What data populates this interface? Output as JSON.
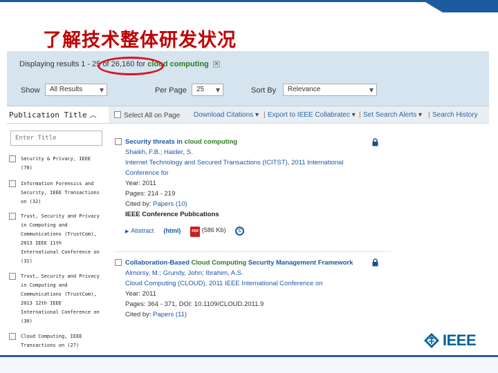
{
  "slide": {
    "title": "了解技术整体研发状况",
    "logo_text": "IEEE",
    "colors": {
      "title": "#c00000",
      "brand": "#00629b",
      "accent_bar": "#1e5aa0",
      "highlight_ring": "#d8141d"
    }
  },
  "search": {
    "results_prefix": "Displaying results 1 - 25 of 26,160 for",
    "query": "cloud computing",
    "clear_icon": "close-icon",
    "show_label": "Show",
    "show_value": "All Results",
    "per_page_label": "Per Page",
    "per_page_value": "25",
    "sort_label": "Sort By",
    "sort_value": "Relevance"
  },
  "filters": {
    "header": "Publication Title",
    "title_placeholder": "Enter Title",
    "items": [
      {
        "label": "Security & Privacy, IEEE\n(70)"
      },
      {
        "label": "Information Forensics and\nSecurity, IEEE Transactions\non (32)"
      },
      {
        "label": "Trust, Security and Privacy\nin Computing and\nCommunications (TrustCom),\n2013 IEEE 11th\nInternational Conference on\n(31)"
      },
      {
        "label": "Trust, Security and Privacy\nin Computing and\nCommunications (TrustCom),\n2013 12th IEEE\nInternational Conference on\n(30)"
      },
      {
        "label": "Cloud Computing, IEEE\nTransactions on (27)"
      }
    ]
  },
  "toolbar": {
    "select_all": "Select All on Page",
    "download": "Download Citations",
    "export": "Export to IEEE Collabratec",
    "alerts": "Set Search Alerts",
    "history": "Search History"
  },
  "results": [
    {
      "title_pre": "Security threats in ",
      "title_hl": "cloud computing",
      "title_post": "",
      "authors": "Shaikh, F.B.; Haider, S.",
      "venue": "Internet Technology and Secured Transactions (ICITST), 2011 International Conference for",
      "year": "Year: 2011",
      "pages": "Pages: 214 - 219",
      "cited_prefix": "Cited by: ",
      "cited_link": "Papers (10)",
      "pub_type": "IEEE Conference Publications",
      "abstract": "Abstract",
      "html": "(html)",
      "pdf_size": "(586 Kb)",
      "pdf_icon_text": "PDF"
    },
    {
      "title_pre": "Collaboration-Based ",
      "title_hl": "Cloud Computing",
      "title_post": " Security Management Framework",
      "authors": "Almorsy, M.; Grundy, John; Ibrahim, A.S.",
      "venue": "Cloud Computing (CLOUD), 2011 IEEE International Conference on",
      "year": "Year: 2011",
      "pages": "Pages: 364 - 371, DOI: 10.1109/CLOUD.2011.9",
      "cited_prefix": "Cited by: ",
      "cited_link": "Papers (11)"
    }
  ]
}
